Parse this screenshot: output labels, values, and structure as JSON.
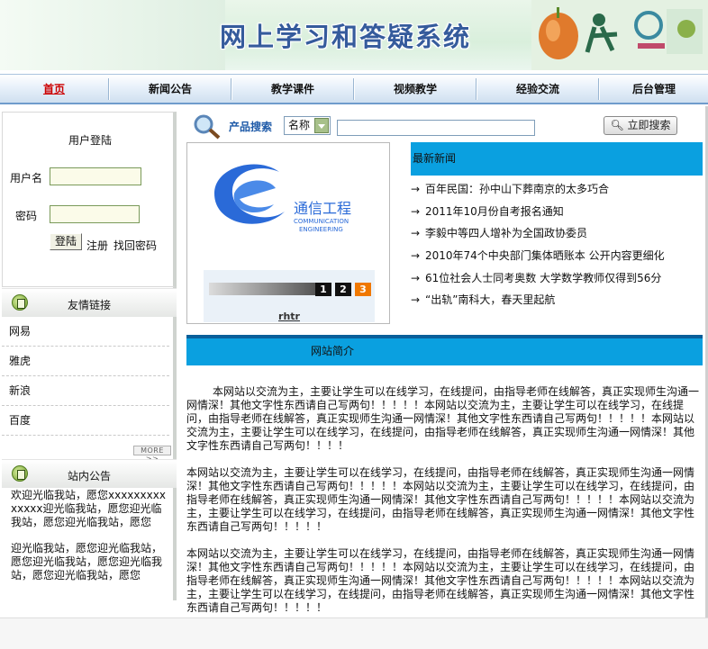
{
  "banner": {
    "title": "网上学习和答疑系统"
  },
  "nav": {
    "items": [
      "首页",
      "新闻公告",
      "教学课件",
      "视频教学",
      "经验交流",
      "后台管理"
    ]
  },
  "login": {
    "title": "用户登陆",
    "username_label": "用户名",
    "password_label": "密码",
    "username_value": "",
    "password_value": "",
    "login_button": "登陆",
    "register_link": "注册",
    "recover_link": "找回密码"
  },
  "links": {
    "title": "友情链接",
    "items": [
      "网易",
      "雅虎",
      "新浪",
      "百度"
    ],
    "more": "MORE >>"
  },
  "notice": {
    "title": "站内公告",
    "paragraphs": [
      "欢迎光临我站，愿您xxxxxxxxxxxxxx迎光临我站，愿您迎光临我站，愿您迎光临我站，愿您",
      "迎光临我站，愿您迎光临我站，愿您迎光临我站，愿您迎光临我站，愿您迎光临我站，愿您"
    ]
  },
  "search": {
    "label": "产品搜索",
    "select_value": "名称",
    "input_value": "",
    "button": "立即搜索"
  },
  "slideshow": {
    "logo_text_cn": "通信工程",
    "logo_text_en1": "COMMUNICATION",
    "logo_text_en2": "ENGINEERING",
    "pages": [
      "1",
      "2",
      "3"
    ],
    "caption": "rhtr"
  },
  "news": {
    "title": "最新新闻",
    "items": [
      "百年民国：孙中山下葬南京的太多巧合",
      "2011年10月份自考报名通知",
      "李毅中等四人增补为全国政协委员",
      "2010年74个中央部门集体晒账本 公开内容更细化",
      "61位社会人士同考奥数 大学数学教师仅得到56分",
      "“出轨”南科大，春天里起航"
    ]
  },
  "intro": {
    "title": "网站简介",
    "paragraphs": [
      "本网站以交流为主，主要让学生可以在线学习，在线提问，由指导老师在线解答，真正实现师生沟通一网情深！其他文字性东西请自己写两句！！！！！本网站以交流为主，主要让学生可以在线学习，在线提问，由指导老师在线解答，真正实现师生沟通一网情深！其他文字性东西请自己写两句！！！！！本网站以交流为主，主要让学生可以在线学习，在线提问，由指导老师在线解答，真正实现师生沟通一网情深！其他文字性东西请自己写两句！！！！",
      "本网站以交流为主，主要让学生可以在线学习，在线提问，由指导老师在线解答，真正实现师生沟通一网情深！其他文字性东西请自己写两句！！！！！本网站以交流为主，主要让学生可以在线学习，在线提问，由指导老师在线解答，真正实现师生沟通一网情深！其他文字性东西请自己写两句！！！！！本网站以交流为主，主要让学生可以在线学习，在线提问，由指导老师在线解答，真正实现师生沟通一网情深！其他文字性东西请自己写两句！！！！！",
      "本网站以交流为主，主要让学生可以在线学习，在线提问，由指导老师在线解答，真正实现师生沟通一网情深！其他文字性东西请自己写两句！！！！！本网站以交流为主，主要让学生可以在线学习，在线提问，由指导老师在线解答，真正实现师生沟通一网情深！其他文字性东西请自己写两句！！！！！本网站以交流为主，主要让学生可以在线学习，在线提问，由指导老师在线解答，真正实现师生沟通一网情深！其他文字性东西请自己写两句！！！！！"
    ]
  },
  "colors": {
    "nav_active": "#cc0000",
    "section_header": "#0aa0e0",
    "search_label": "#1e5aa8",
    "slide_active": "#f07800"
  }
}
